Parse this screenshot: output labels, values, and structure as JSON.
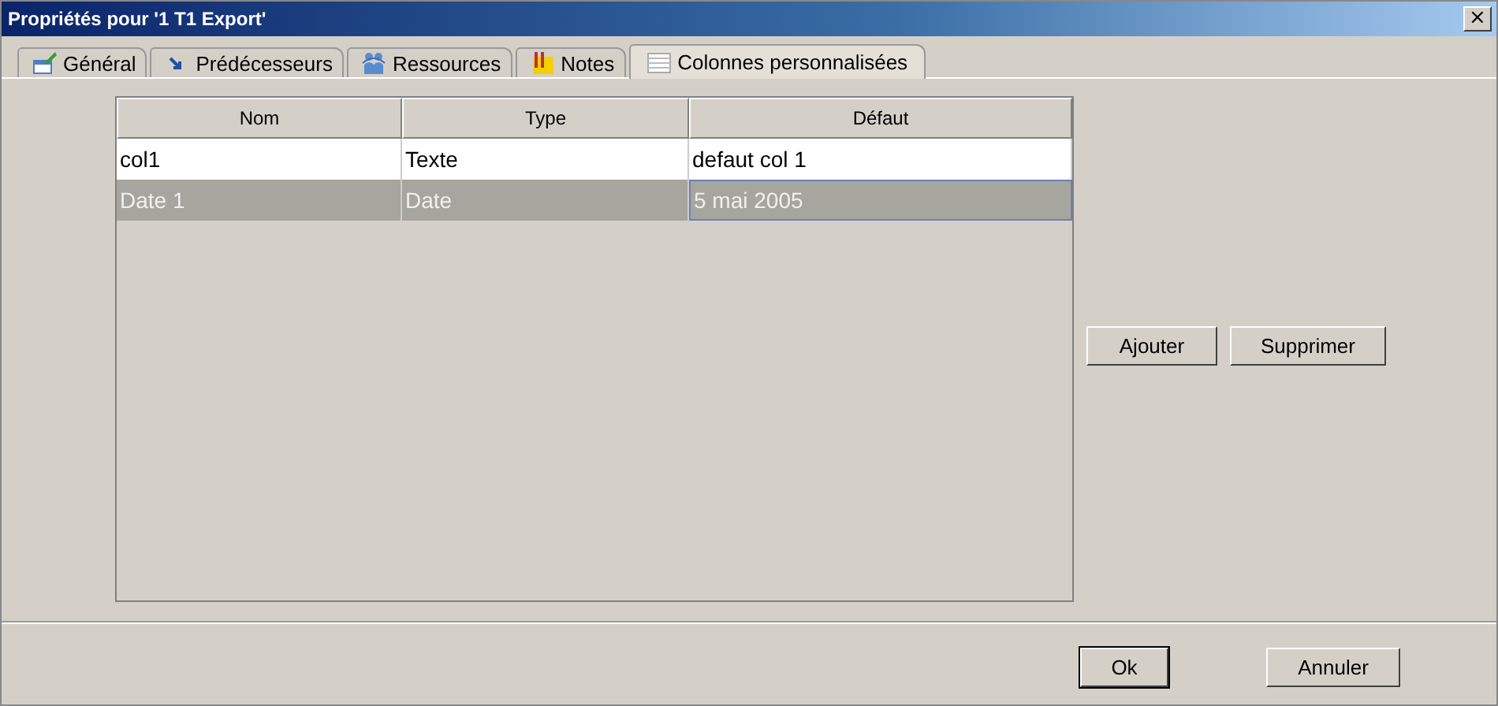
{
  "window": {
    "title": "Propriétés pour '1 T1 Export'",
    "close": "×"
  },
  "tabs": [
    {
      "label": "Général",
      "kind": "general",
      "selected": false
    },
    {
      "label": "Prédécesseurs",
      "kind": "arrow",
      "selected": false
    },
    {
      "label": "Ressources",
      "kind": "people",
      "selected": false
    },
    {
      "label": "Notes",
      "kind": "notes",
      "selected": false
    },
    {
      "label": "Colonnes personnalisées",
      "kind": "table",
      "selected": true
    }
  ],
  "table": {
    "columns": [
      "Nom",
      "Type",
      "Défaut"
    ],
    "rows": [
      {
        "cells": [
          {
            "text": "col1",
            "focused": false
          },
          {
            "text": "Texte",
            "focused": false
          },
          {
            "text": "defaut col 1",
            "focused": false
          }
        ],
        "selected": false
      },
      {
        "cells": [
          {
            "text": "Date 1",
            "focused": false
          },
          {
            "text": "Date",
            "focused": false
          },
          {
            "text": "5 mai 2005",
            "focused": true
          }
        ],
        "selected": true
      }
    ]
  },
  "side_buttons": [
    "Ajouter",
    "Supprimer"
  ],
  "buttons": [
    {
      "label": "Ok",
      "default": true
    },
    {
      "label": "Annuler",
      "default": false
    }
  ]
}
